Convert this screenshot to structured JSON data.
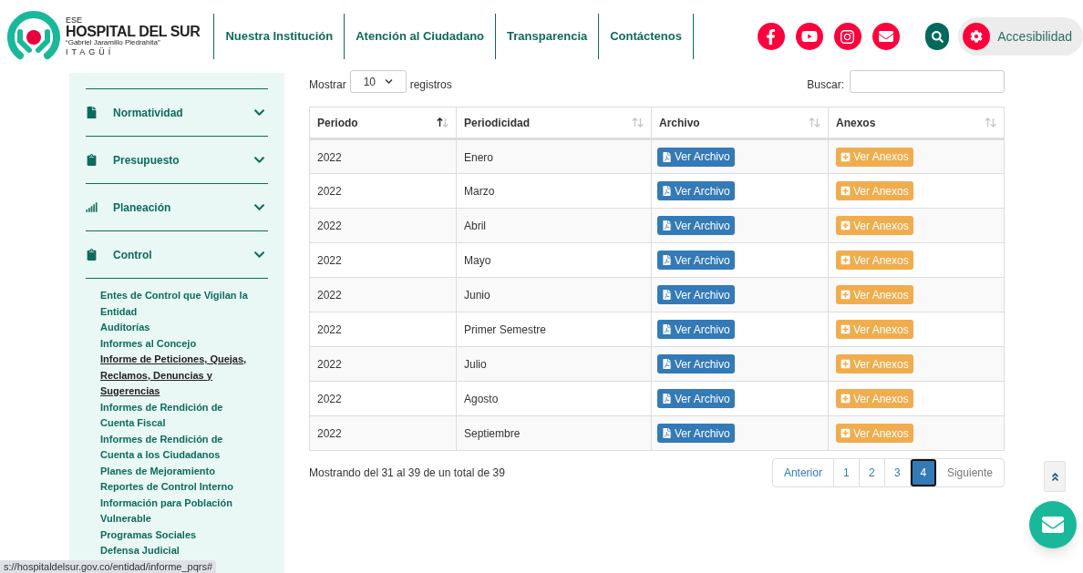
{
  "logo": {
    "prefix": "ESE",
    "name": "HOSPITAL DEL SUR",
    "subtitle": "“Gabriel Jaramillo Piedrahita”",
    "city": "ITAGÜÍ"
  },
  "nav": [
    "Nuestra Institución",
    "Atención al Ciudadano",
    "Transparencia",
    "Contáctenos"
  ],
  "social": [
    {
      "kind": "facebook"
    },
    {
      "kind": "youtube"
    },
    {
      "kind": "instagram"
    },
    {
      "kind": "mail"
    }
  ],
  "accessibility": {
    "label": "Accesibilidad"
  },
  "sidebar": {
    "items": [
      {
        "label": "Normatividad",
        "kind": "file"
      },
      {
        "label": "Presupuesto",
        "kind": "clipboard"
      },
      {
        "label": "Planeación",
        "kind": "signal"
      },
      {
        "label": "Control",
        "kind": "clipboard",
        "children": [
          {
            "label": "Entes de Control que Vigilan la Entidad",
            "selected": false
          },
          {
            "label": "Auditorías",
            "selected": false
          },
          {
            "label": "Informes al Concejo",
            "selected": false
          },
          {
            "label": "Informe de Peticiones, Quejas, Reclamos, Denuncias y Sugerencias",
            "selected": true
          },
          {
            "label": "Informes de Rendición de Cuenta Fiscal",
            "selected": false
          },
          {
            "label": "Informes de Rendición de Cuenta a los Ciudadanos",
            "selected": false
          },
          {
            "label": "Planes de Mejoramiento",
            "selected": false
          },
          {
            "label": "Reportes de Control Interno",
            "selected": false
          },
          {
            "label": "Información para Población Vulnerable",
            "selected": false
          },
          {
            "label": "Programas Sociales",
            "selected": false
          },
          {
            "label": "Defensa Judicial",
            "selected": false
          }
        ]
      }
    ]
  },
  "length_menu": {
    "before": "Mostrar",
    "value": "10",
    "after": "registros"
  },
  "search": {
    "label": "Buscar:"
  },
  "table": {
    "columns": [
      {
        "label": "Periodo",
        "sorted": true
      },
      {
        "label": "Periodicidad",
        "sorted": false
      },
      {
        "label": "Archivo",
        "sorted": false
      },
      {
        "label": "Anexos",
        "sorted": false
      }
    ],
    "rows": [
      {
        "periodo": "2022",
        "periodicidad": "Enero",
        "archivo": "Ver Archivo",
        "anexos": "Ver Anexos"
      },
      {
        "periodo": "2022",
        "periodicidad": "Marzo",
        "archivo": "Ver Archivo",
        "anexos": "Ver Anexos"
      },
      {
        "periodo": "2022",
        "periodicidad": "Abril",
        "archivo": "Ver Archivo",
        "anexos": "Ver Anexos"
      },
      {
        "periodo": "2022",
        "periodicidad": "Mayo",
        "archivo": "Ver Archivo",
        "anexos": "Ver Anexos"
      },
      {
        "periodo": "2022",
        "periodicidad": "Junio",
        "archivo": "Ver Archivo",
        "anexos": "Ver Anexos"
      },
      {
        "periodo": "2022",
        "periodicidad": "Primer Semestre",
        "archivo": "Ver Archivo",
        "anexos": "Ver Anexos"
      },
      {
        "periodo": "2022",
        "periodicidad": "Julio",
        "archivo": "Ver Archivo",
        "anexos": "Ver Anexos"
      },
      {
        "periodo": "2022",
        "periodicidad": "Agosto",
        "archivo": "Ver Archivo",
        "anexos": "Ver Anexos"
      },
      {
        "periodo": "2022",
        "periodicidad": "Septiembre",
        "archivo": "Ver Archivo",
        "anexos": "Ver Anexos"
      }
    ]
  },
  "info": "Mostrando del 31 al 39 de un total de 39",
  "pagination": {
    "previous": "Anterior",
    "next": "Siguiente",
    "pages": [
      {
        "label": "1",
        "selected": false
      },
      {
        "label": "2",
        "selected": false
      },
      {
        "label": "3",
        "selected": false
      },
      {
        "label": "4",
        "selected": true
      }
    ]
  },
  "status_bar": {
    "url": "s://hospitaldelsur.gov.co/entidad/informe_pqrs#"
  }
}
